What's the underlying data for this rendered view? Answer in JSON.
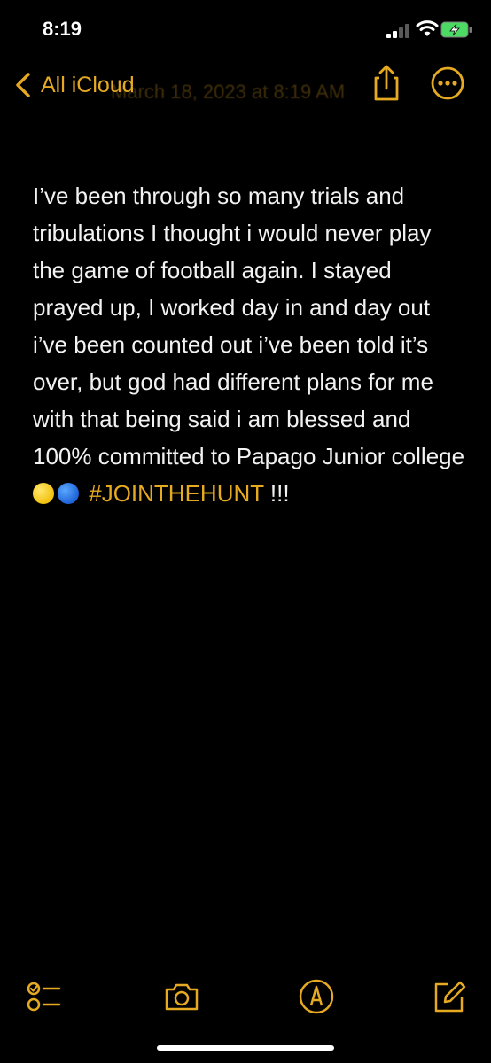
{
  "status_bar": {
    "time": "8:19",
    "battery_color": "#4CD964"
  },
  "nav": {
    "back_label": "All iCloud",
    "date_ghost": "March 18, 2023 at 8:19 AM"
  },
  "note": {
    "body_text": "I’ve been through so many trials and tribulations I thought i would never play the game of football again. I stayed prayed up, I worked day in and day out i’ve been counted out i’ve been told it’s over, but god had different plans for me with that being said i am blessed and 100% committed to Papago Junior college",
    "emoji_1": "yellow-circle",
    "emoji_2": "blue-circle",
    "hashtag": "#JOINTHEHUNT",
    "trailing_text": " !!!"
  },
  "toolbar": {
    "items": [
      "checklist-icon",
      "camera-icon",
      "markup-icon",
      "compose-icon"
    ]
  },
  "colors": {
    "accent": "#E5A922",
    "background": "#000000",
    "text": "#F2F2F2"
  }
}
